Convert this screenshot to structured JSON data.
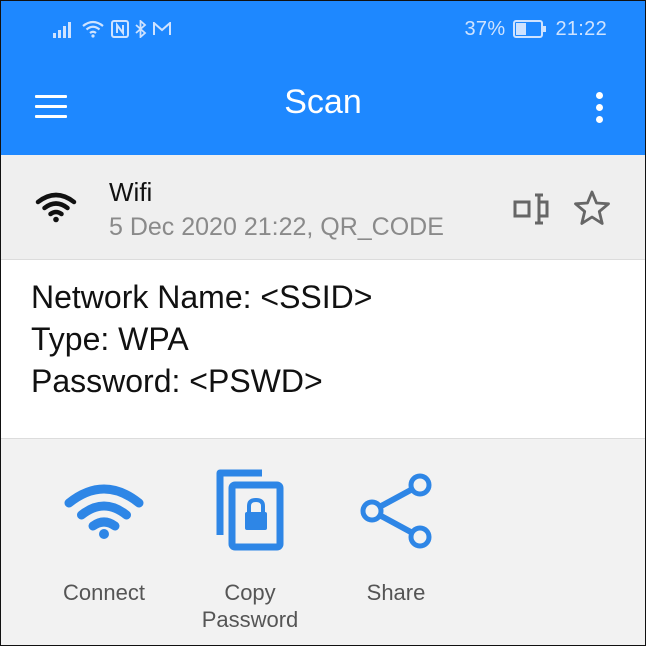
{
  "status_bar": {
    "battery": "37%",
    "time": "21:22",
    "icons": [
      "signal-icon",
      "wifi-icon",
      "nfc-icon",
      "bluetooth-icon",
      "mail-icon",
      "battery-icon"
    ]
  },
  "app_bar": {
    "title": "Scan",
    "menu_icon": "hamburger-menu-icon",
    "overflow_icon": "more-vert-icon",
    "color": "#1e88ff"
  },
  "result": {
    "type": "Wifi",
    "meta": "5 Dec 2020 21:22, QR_CODE",
    "icons": [
      "wifi-icon",
      "edit-text-icon",
      "star-outline-icon"
    ]
  },
  "content": {
    "lines": [
      "Network Name: <SSID>",
      "Type: WPA",
      "Password: <PSWD>"
    ]
  },
  "actions": [
    {
      "label": "Connect",
      "icon": "wifi-icon"
    },
    {
      "label": "Copy\nPassword",
      "icon": "copy-lock-icon"
    },
    {
      "label": "Share",
      "icon": "share-icon"
    }
  ],
  "colors": {
    "accent": "#1e88ff",
    "action_icon": "#2e86e6"
  }
}
